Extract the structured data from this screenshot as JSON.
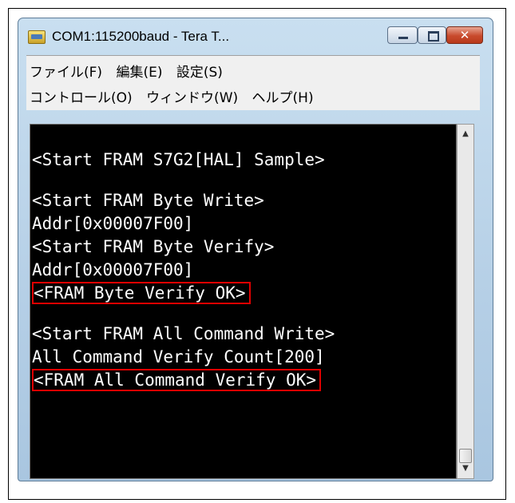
{
  "window": {
    "title": "COM1:115200baud - Tera T...",
    "close_symbol": "✕",
    "app_icon": "teraterm-icon"
  },
  "menu": {
    "row1": [
      "ファイル(F)",
      "編集(E)",
      "設定(S)"
    ],
    "row2": [
      "コントロール(O)",
      "ウィンドウ(W)",
      "ヘルプ(H)"
    ]
  },
  "terminal": {
    "lines": [
      "<Start FRAM S7G2[HAL] Sample>",
      "",
      "<Start FRAM Byte Write>",
      "Addr[0x00007F00]",
      "<Start FRAM Byte Verify>",
      "Addr[0x00007F00]",
      "<FRAM Byte Verify OK>",
      "",
      "<Start FRAM All Command Write>",
      "All Command Verify Count[200]",
      "<FRAM All Command Verify OK>"
    ],
    "highlight_color": "#e00000"
  },
  "scrollbar": {
    "up_arrow": "▲",
    "down_arrow": "▼"
  }
}
